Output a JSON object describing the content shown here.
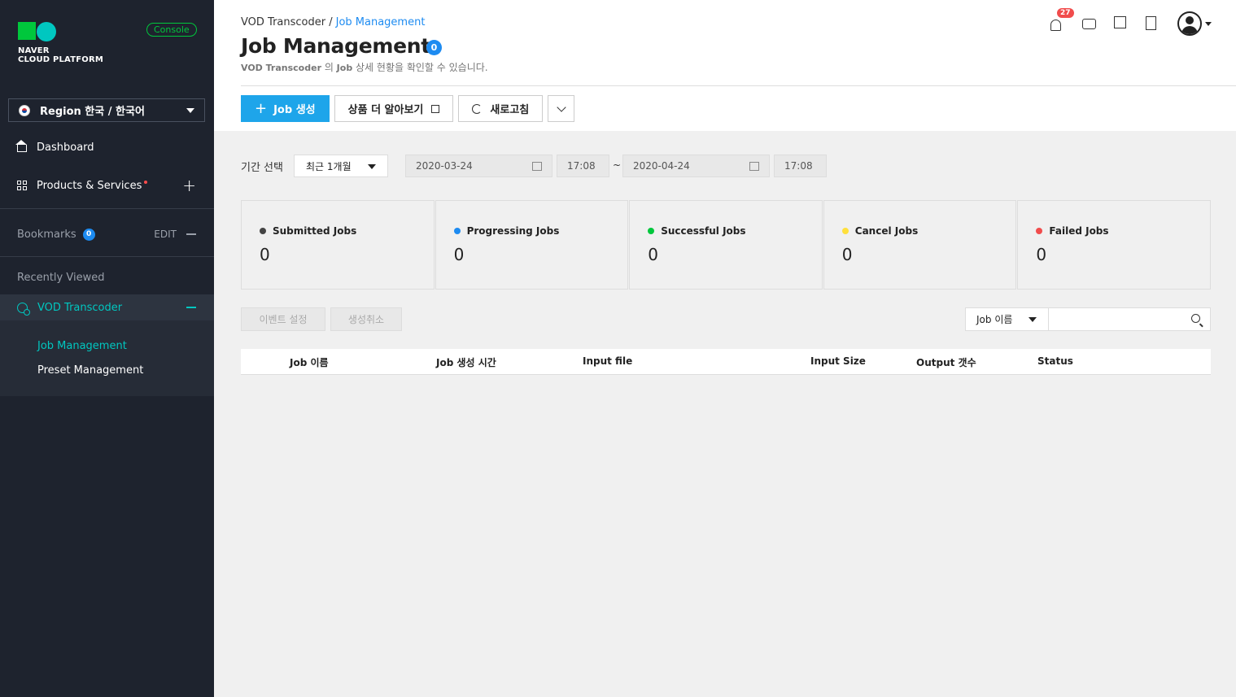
{
  "sidebar": {
    "logo_line1": "NAVER",
    "logo_line2": "CLOUD PLATFORM",
    "console_label": "Console",
    "region_label": "Region 한국 / 한국어",
    "dashboard_label": "Dashboard",
    "products_label": "Products & Services",
    "bookmarks_label": "Bookmarks",
    "bookmarks_count": "0",
    "edit_label": "EDIT",
    "recently_viewed_label": "Recently Viewed",
    "vod_label": "VOD Transcoder",
    "sub_items": [
      "Job Management",
      "Preset Management"
    ]
  },
  "header": {
    "breadcrumb_root": "VOD Transcoder /",
    "breadcrumb_current": "Job Management",
    "title": "Job Management",
    "title_count": "0",
    "subtitle_bold": "VOD Transcoder",
    "subtitle_mid": " 의 ",
    "subtitle_bold2": "Job",
    "subtitle_rest": " 상세 현황을 확인할 수 있습니다.",
    "notification_count": "27"
  },
  "toolbar": {
    "create_label": "Job 생성",
    "learn_more_label": "상품 더 알아보기",
    "refresh_label": "새로고침"
  },
  "filter": {
    "label": "기간 선택",
    "period": "최근 1개월",
    "start_date": "2020-03-24",
    "start_time": "17:08",
    "tilde": "~",
    "end_date": "2020-04-24",
    "end_time": "17:08"
  },
  "stats": [
    {
      "label": "Submitted Jobs",
      "value": "0",
      "color": "#444444"
    },
    {
      "label": "Progressing Jobs",
      "value": "0",
      "color": "#1d8bf1"
    },
    {
      "label": "Successful Jobs",
      "value": "0",
      "color": "#00c73c"
    },
    {
      "label": "Cancel Jobs",
      "value": "0",
      "color": "#ffe03c"
    },
    {
      "label": "Failed Jobs",
      "value": "0",
      "color": "#f14c4c"
    }
  ],
  "actions": {
    "event_label": "이벤트 설정",
    "cancel_label": "생성취소",
    "search_field": "Job 이름",
    "search_placeholder": ""
  },
  "table": {
    "columns": [
      "Job 이름",
      "Job 생성 시간",
      "Input file",
      "Input Size",
      "Output 갯수",
      "Status"
    ]
  }
}
